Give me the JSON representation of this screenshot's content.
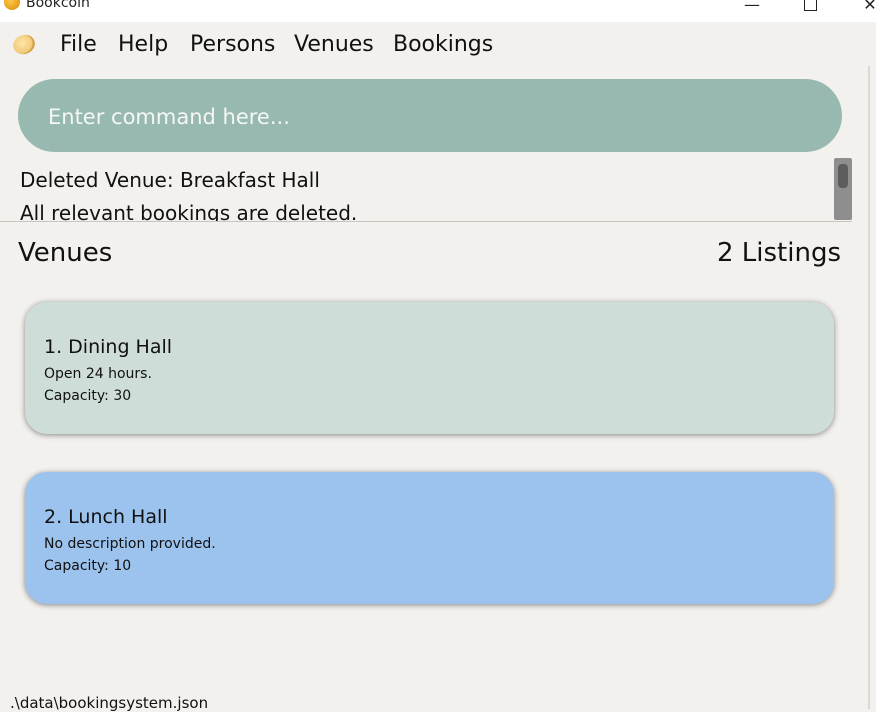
{
  "window": {
    "title": "Bookcoin",
    "minimize": "—",
    "close": "✕"
  },
  "menu": {
    "items": [
      "File",
      "Help",
      "Persons",
      "Venues",
      "Bookings"
    ]
  },
  "command": {
    "placeholder": "Enter command here..."
  },
  "result": {
    "lines": [
      "Deleted Venue: Breakfast Hall",
      "All relevant bookings are deleted."
    ]
  },
  "list": {
    "title": "Venues",
    "count": "2 Listings",
    "cards": [
      {
        "name": "1.  Dining Hall",
        "description": "Open 24 hours.",
        "capacity": "Capacity: 30",
        "color": "#cfddd8"
      },
      {
        "name": "2.  Lunch Hall",
        "description": "No description provided.",
        "capacity": "Capacity: 10",
        "color": "#9bc3ee"
      }
    ]
  },
  "status": {
    "path": ".\\data\\bookingsystem.json"
  },
  "colors": {
    "command_bg": "#98b9b0",
    "background": "#f3f1ee"
  }
}
